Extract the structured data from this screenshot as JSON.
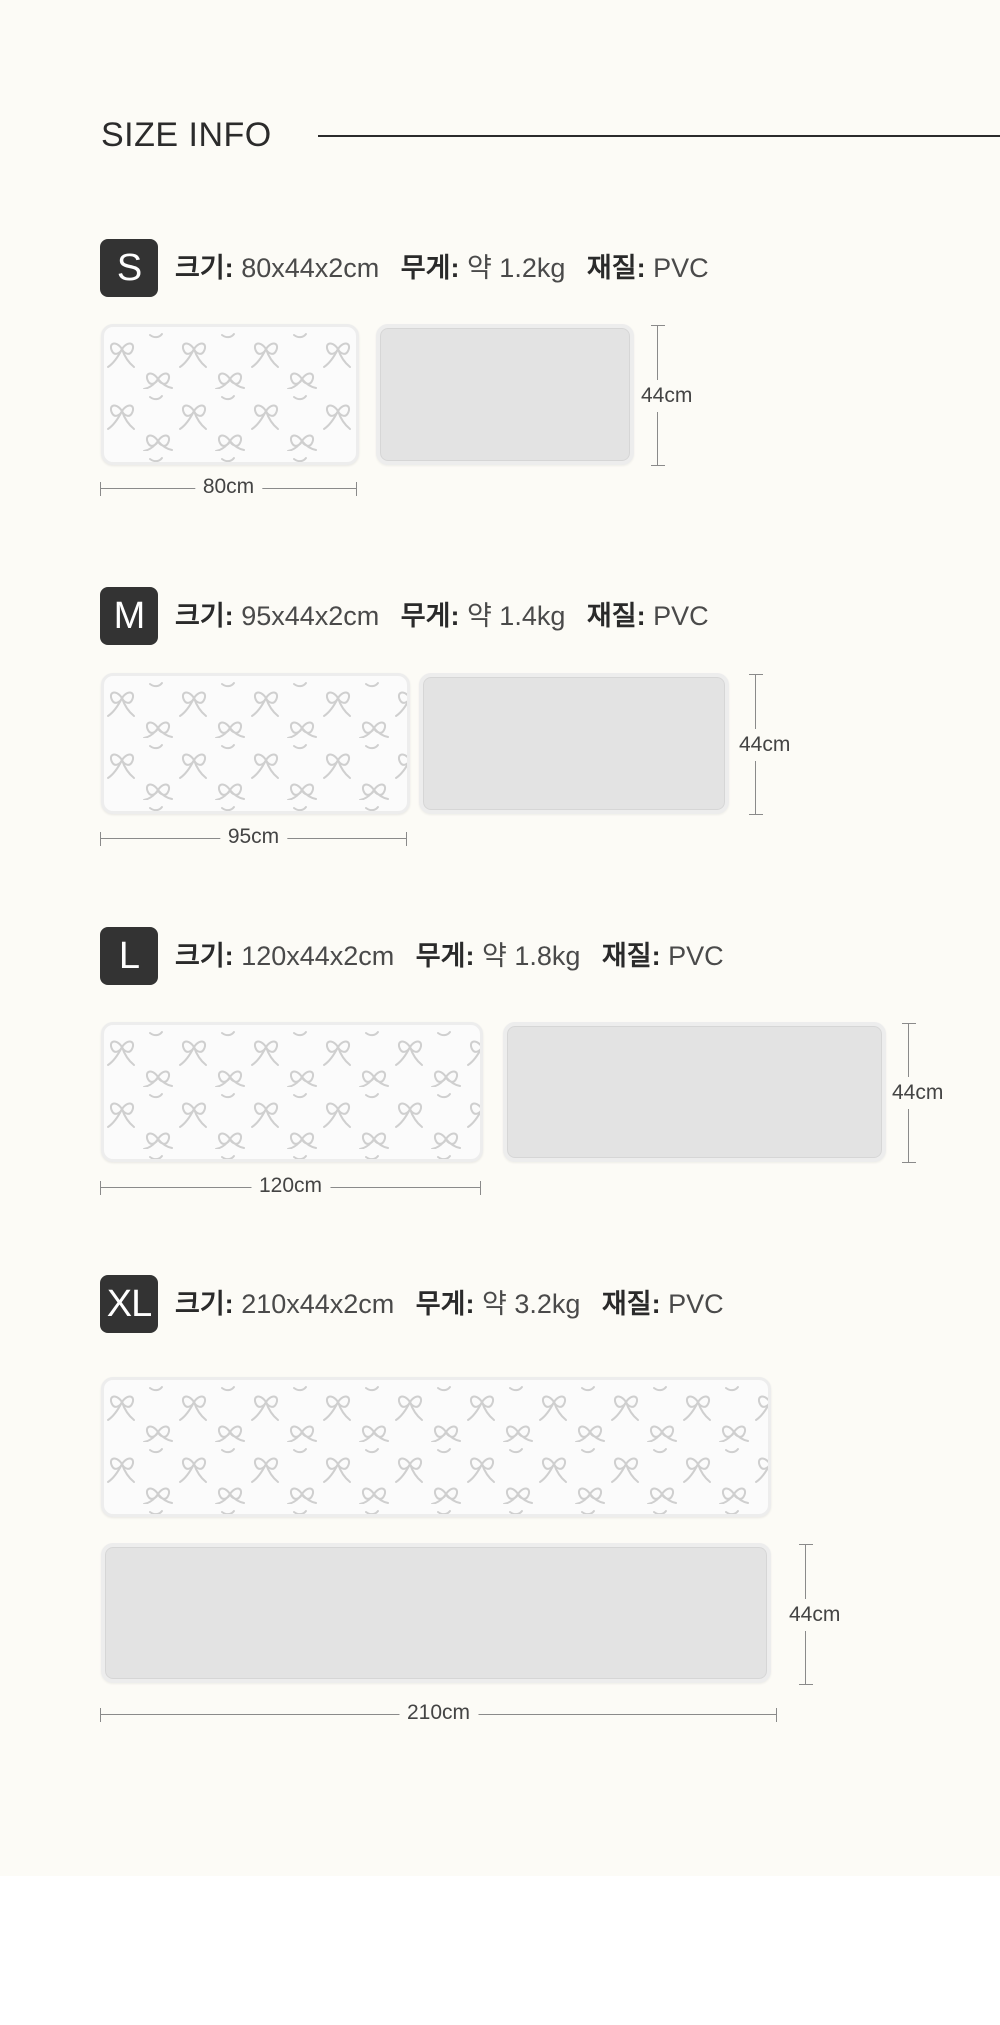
{
  "page": {
    "title": "SIZE INFO"
  },
  "spec_keys": {
    "size": "크기:",
    "weight": "무게:",
    "material": "재질:"
  },
  "sizes": [
    {
      "badge": "S",
      "size": "80x44x2cm",
      "weight": "약 1.2kg",
      "material": "PVC",
      "width_label": "80cm",
      "height_label": "44cm"
    },
    {
      "badge": "M",
      "size": "95x44x2cm",
      "weight": "약 1.4kg",
      "material": "PVC",
      "width_label": "95cm",
      "height_label": "44cm"
    },
    {
      "badge": "L",
      "size": "120x44x2cm",
      "weight": "약 1.8kg",
      "material": "PVC",
      "width_label": "120cm",
      "height_label": "44cm"
    },
    {
      "badge": "XL",
      "size": "210x44x2cm",
      "weight": "약 3.2kg",
      "material": "PVC",
      "width_label": "210cm",
      "height_label": "44cm"
    }
  ],
  "colors": {
    "background": "#fcfbf6",
    "badge": "#333333",
    "plain_mat": "#e3e3e3",
    "pattern_mat": "#fbfbfb",
    "ribbon_pattern": "#cfcfcf"
  }
}
